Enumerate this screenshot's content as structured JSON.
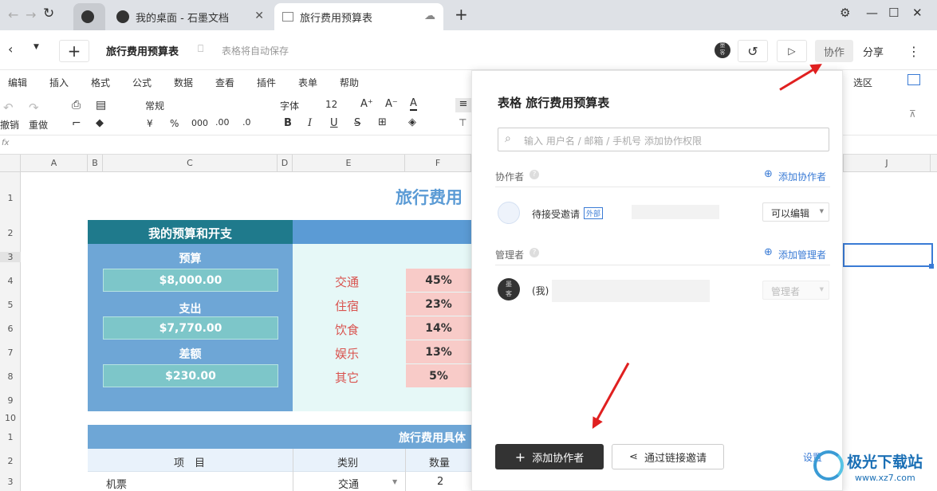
{
  "browser": {
    "tabs": [
      {
        "label": ""
      },
      {
        "label": "我的桌面 - 石墨文档"
      },
      {
        "label": "旅行费用预算表"
      }
    ],
    "new_tab": "+",
    "settings_icon": "gear-icon"
  },
  "doc_header": {
    "title": "旅行费用预算表",
    "autosave": "表格将自动保存",
    "collab_label": "协作",
    "share_label": "分享",
    "avatar_text": "墨\n客"
  },
  "menu": [
    "编辑",
    "插入",
    "格式",
    "公式",
    "数据",
    "查看",
    "插件",
    "表单",
    "帮助"
  ],
  "menu_right": "选区",
  "toolbar": {
    "undo": "撤销",
    "redo": "重做",
    "format": "常规",
    "font": "字体",
    "font_size": "12",
    "currency": "¥",
    "percent": "%",
    "thousands": "000",
    "dec_inc": ".00",
    "dec_dec": ".0",
    "bold": "B",
    "italic": "I",
    "underline": "U",
    "strike": "S"
  },
  "formula": {
    "fx": "fx"
  },
  "columns": [
    "A",
    "B",
    "C",
    "D",
    "E",
    "F",
    "J"
  ],
  "rows": [
    "1",
    "2",
    "3",
    "4",
    "5",
    "6",
    "7",
    "8",
    "9",
    "10",
    "1",
    "2",
    "3"
  ],
  "sheet": {
    "title": "旅行费用",
    "budget_header": "我的预算和开支",
    "budget_label": "预算",
    "budget_value": "$8,000.00",
    "spend_label": "支出",
    "spend_value": "$7,770.00",
    "diff_label": "差额",
    "diff_value": "$230.00",
    "categories": [
      {
        "name": "交通",
        "pct": "45%"
      },
      {
        "name": "住宿",
        "pct": "23%"
      },
      {
        "name": "饮食",
        "pct": "14%"
      },
      {
        "name": "娱乐",
        "pct": "13%"
      },
      {
        "name": "其它",
        "pct": "5%"
      }
    ],
    "detail_header": "旅行费用具体",
    "detail_cols": {
      "item": "项　目",
      "category": "类别",
      "qty": "数量"
    },
    "detail_row": {
      "item": "机票",
      "category": "交通",
      "qty": "2"
    }
  },
  "panel": {
    "title": "表格 旅行费用预算表",
    "search_placeholder": "输入 用户名 / 邮箱 / 手机号 添加协作权限",
    "collaborators_label": "协作者",
    "add_collaborator": "添加协作者",
    "pending_user": "待接受邀请",
    "external_badge": "外部",
    "permission": "可以编辑",
    "admins_label": "管理者",
    "add_admin": "添加管理者",
    "me_label": "(我)",
    "admin_role": "管理者",
    "add_collab_button": "添加协作者",
    "link_invite_button": "通过链接邀请",
    "settings": "设置"
  },
  "watermark": {
    "text": "极光下载站",
    "url": "www.xz7.com"
  }
}
